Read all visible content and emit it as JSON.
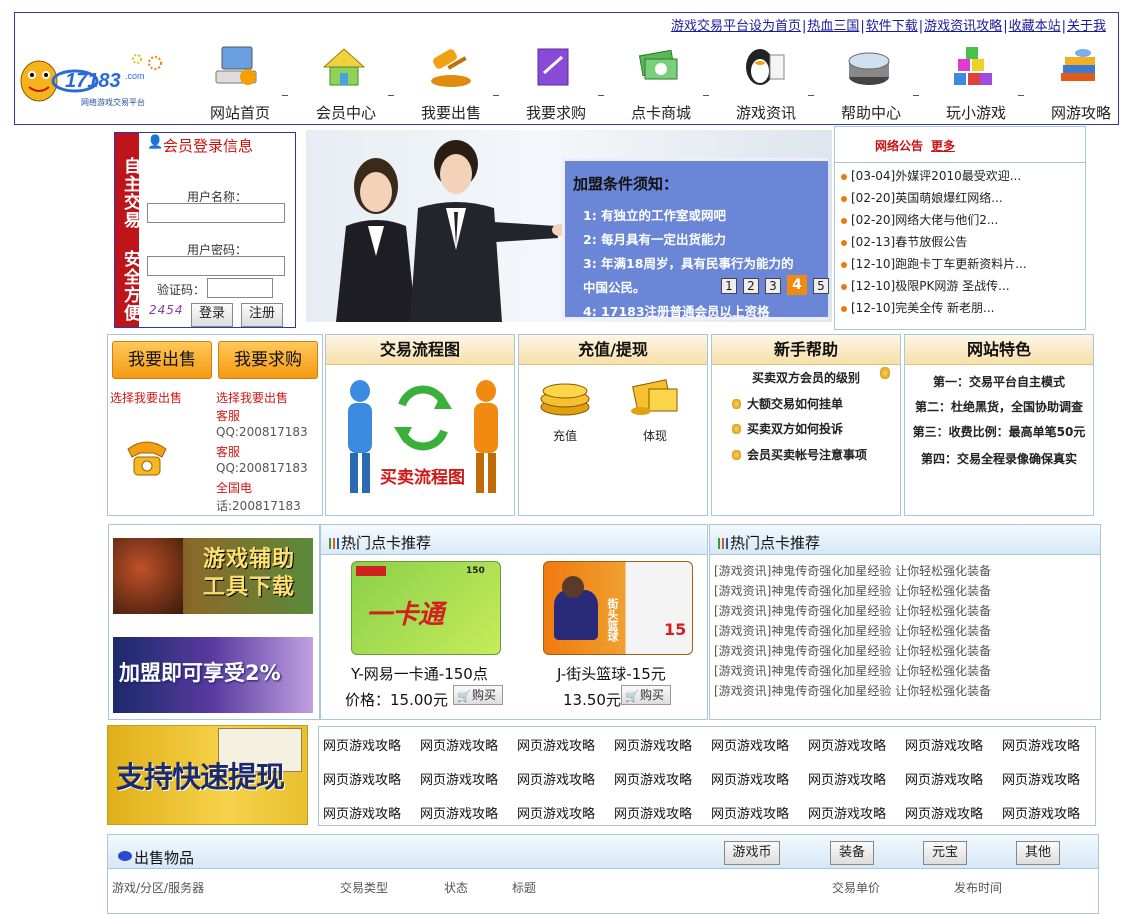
{
  "header": {
    "top_links": [
      "游戏交易平台设为首页",
      "热血三国",
      "软件下载",
      "游戏资讯攻略",
      "收藏本站",
      "关于我"
    ],
    "logo_text": "17183.com",
    "logo_sub": "网络游戏交易平台",
    "nav": [
      {
        "label": "网站首页",
        "icon": "computer-icon"
      },
      {
        "label": "会员中心",
        "icon": "house-icon"
      },
      {
        "label": "我要出售",
        "icon": "gavel-icon"
      },
      {
        "label": "我要求购",
        "icon": "document-icon"
      },
      {
        "label": "点卡商城",
        "icon": "money-icon"
      },
      {
        "label": "游戏资讯",
        "icon": "qq-penguin-icon"
      },
      {
        "label": "帮助中心",
        "icon": "disk-icon"
      },
      {
        "label": "玩小游戏",
        "icon": "cubes-icon"
      },
      {
        "label": "网游攻略",
        "icon": "books-icon"
      }
    ]
  },
  "login": {
    "side_text": "自主交易 安全方便",
    "title": "会员登录信息",
    "username_label": "用户名称：",
    "password_label": "用户密码：",
    "captcha_label": "验证码：",
    "captcha_text": "2454",
    "login_button": "登录",
    "register_button": "注册"
  },
  "banner": {
    "board_title": "加盟条件须知：",
    "conditions": [
      "1: 有独立的工作室或网吧",
      "2: 每月具有一定出货能力",
      "3: 年满18周岁，具有民事行为能力的",
      "中国公民。",
      "4: 17183注册普通会员以上资格"
    ],
    "pages": [
      "1",
      "2",
      "3",
      "4",
      "5"
    ],
    "active_page": "4"
  },
  "notice": {
    "title": "网络公告",
    "more": "更多",
    "items": [
      "[03-04]外媒评2010最受欢迎...",
      "[02-20]英国萌娘爆红网络...",
      "[02-20]网络大佬与他们2...",
      "[02-13]春节放假公告",
      "[12-10]跑跑卡丁车更新资料片...",
      "[12-10]极限PK网游 圣战传...",
      "[12-10]完美全传 新老朋..."
    ]
  },
  "trade": {
    "sell_button": "我要出售",
    "buy_button": "我要求购",
    "sell_link": "选择我要出售",
    "buy_link": "选择我要出售",
    "contacts": [
      {
        "label": "客服",
        "value": "QQ:200817183"
      },
      {
        "label": "客服",
        "value": "QQ:200817183"
      },
      {
        "label": "全国电",
        "value": "话:200817183"
      }
    ]
  },
  "flow": {
    "title": "交易流程图",
    "caption": "买卖流程图"
  },
  "recharge": {
    "title": "充值/提现",
    "recharge_label": "充值",
    "withdraw_label": "体现"
  },
  "help": {
    "title": "新手帮助",
    "items": [
      "买卖双方会员的级别",
      "大额交易如何挂单",
      "买卖双方如何投诉",
      "会员买卖帐号注意事项"
    ]
  },
  "features": {
    "title": "网站特色",
    "items": [
      "第一：交易平台自主模式",
      "第二：杜绝黑货，全国协助调查",
      "第三：收费比例：最高单笔50元",
      "第四：交易全程录像确保真实"
    ]
  },
  "ads": {
    "ad1": "游戏辅助工具下载",
    "ad2": "加盟即可享受2%",
    "ad3": "支持快速提现"
  },
  "cards": {
    "section_title": "热门点卡推荐",
    "items": [
      {
        "name": "Y-网易一卡通-150点",
        "price": "价格：15.00元",
        "buy": "购买",
        "card_text": "一卡通",
        "card_value": "150"
      },
      {
        "name": "J-街头篮球-15元",
        "price": "13.50元",
        "buy": "购买",
        "card_text": "街头篮球",
        "card_value": "15"
      }
    ]
  },
  "news": {
    "section_title": "热门点卡推荐",
    "items": [
      "[游戏资讯]神鬼传奇强化加星经验 让你轻松强化装备",
      "[游戏资讯]神鬼传奇强化加星经验 让你轻松强化装备",
      "[游戏资讯]神鬼传奇强化加星经验 让你轻松强化装备",
      "[游戏资讯]神鬼传奇强化加星经验 让你轻松强化装备",
      "[游戏资讯]神鬼传奇强化加星经验 让你轻松强化装备",
      "[游戏资讯]神鬼传奇强化加星经验 让你轻松强化装备",
      "[游戏资讯]神鬼传奇强化加星经验 让你轻松强化装备"
    ]
  },
  "guides": {
    "rows": [
      [
        "网页游戏攻略",
        "网页游戏攻略",
        "网页游戏攻略",
        "网页游戏攻略",
        "网页游戏攻略",
        "网页游戏攻略",
        "网页游戏攻略",
        "网页游戏攻略"
      ],
      [
        "网页游戏攻略",
        "网页游戏攻略",
        "网页游戏攻略",
        "网页游戏攻略",
        "网页游戏攻略",
        "网页游戏攻略",
        "网页游戏攻略",
        "网页游戏攻略"
      ],
      [
        "网页游戏攻略",
        "网页游戏攻略",
        "网页游戏攻略",
        "网页游戏攻略",
        "网页游戏攻略",
        "网页游戏攻略",
        "网页游戏攻略",
        "网页游戏攻略"
      ]
    ]
  },
  "sell": {
    "title": "出售物品",
    "tabs": [
      "游戏币",
      "装备",
      "元宝",
      "其他"
    ],
    "columns": [
      "游戏/分区/服务器",
      "交易类型",
      "状态",
      "标题",
      "交易单价",
      "发布时间"
    ]
  },
  "colors": {
    "accent_red": "#c0141b",
    "orange": "#f49a10",
    "border_blue": "#a8c6dc",
    "link_blue": "#1a1a9a"
  }
}
